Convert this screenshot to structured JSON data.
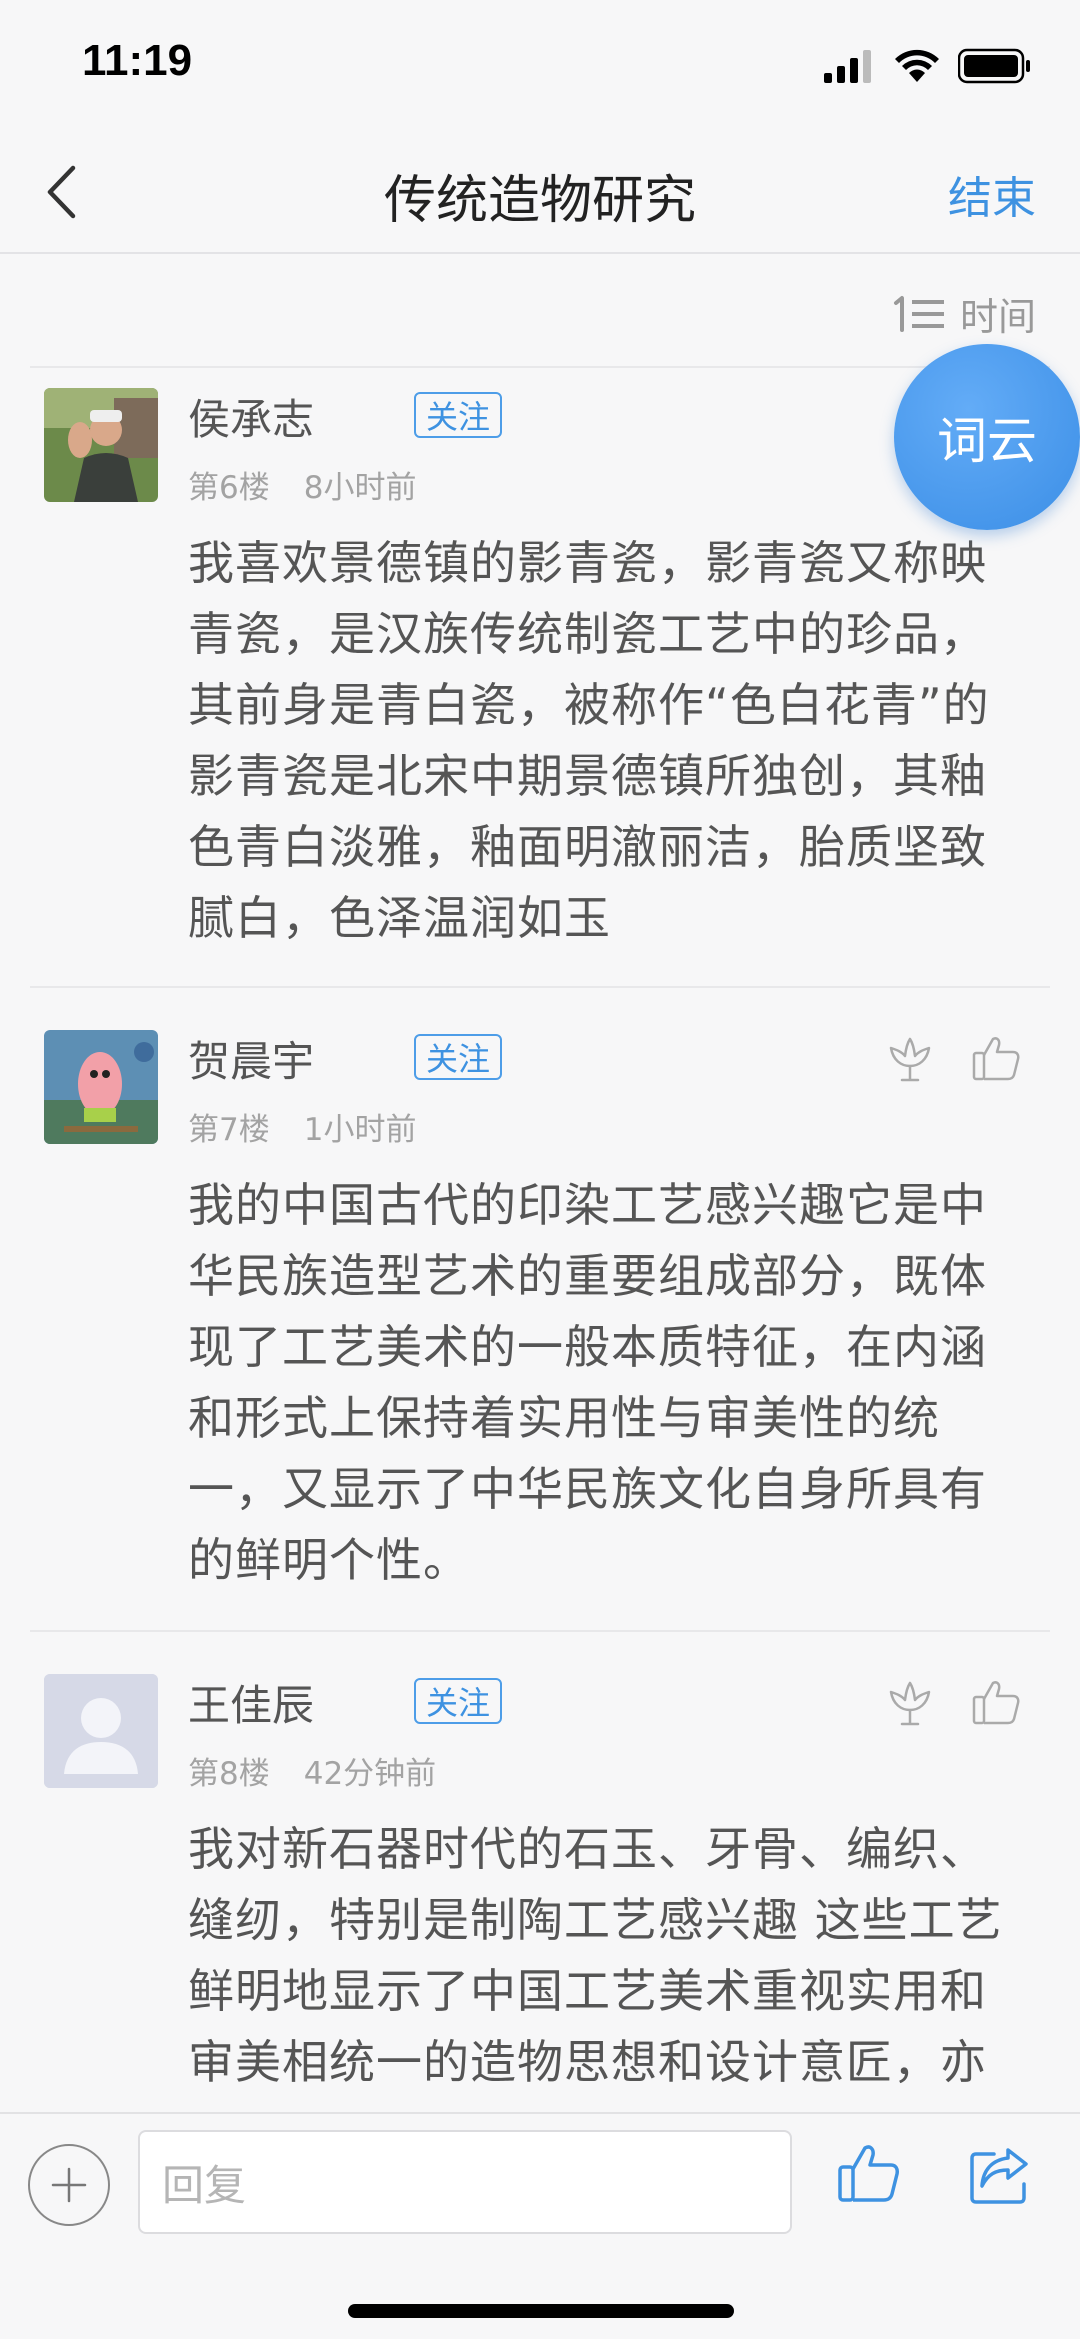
{
  "status_bar": {
    "time": "11:19"
  },
  "nav": {
    "title": "传统造物研究",
    "end_label": "结束"
  },
  "sort": {
    "label": "时间"
  },
  "wordcloud": {
    "label": "词云"
  },
  "comments": [
    {
      "username": "侯承志",
      "follow_label": "关注",
      "floor": "第6楼",
      "time": "8小时前",
      "lines": [
        "我喜欢景德镇的影青瓷，影青瓷又称映",
        "青瓷，是汉族传统制瓷工艺中的珍品，",
        "其前身是青白瓷，被称作“色白花青”的",
        "影青瓷是北宋中期景德镇所独创，其釉",
        "色青白淡雅，釉面明澈丽洁，胎质坚致",
        "腻白，色泽温润如玉"
      ]
    },
    {
      "username": "贺晨宇",
      "follow_label": "关注",
      "floor": "第7楼",
      "time": "1小时前",
      "lines": [
        "我的中国古代的印染工艺感兴趣它是中",
        "华民族造型艺术的重要组成部分，既体",
        "现了工艺美术的一般本质特征，在内涵",
        "和形式上保持着实用性与审美性的统",
        "一，又显示了中华民族文化自身所具有",
        "的鲜明个性。"
      ]
    },
    {
      "username": "王佳辰",
      "follow_label": "关注",
      "floor": "第8楼",
      "time": "42分钟前",
      "lines": [
        "我对新石器时代的石玉、牙骨、编织、",
        "缝纫，特别是制陶工艺感兴趣 这些工艺",
        "鲜明地显示了中国工艺美术重视实用和",
        "审美相统一的造物思想和设计意匠，亦"
      ]
    }
  ],
  "reply": {
    "placeholder": "回复"
  },
  "icons": {
    "back": "chevron-left-icon",
    "sort": "sort-list-icon",
    "flower": "flower-icon",
    "like": "thumbs-up-icon",
    "plus": "plus-icon",
    "share": "share-icon"
  },
  "colors": {
    "accent": "#3e92e1",
    "wordcloud": "#4a9bef"
  }
}
